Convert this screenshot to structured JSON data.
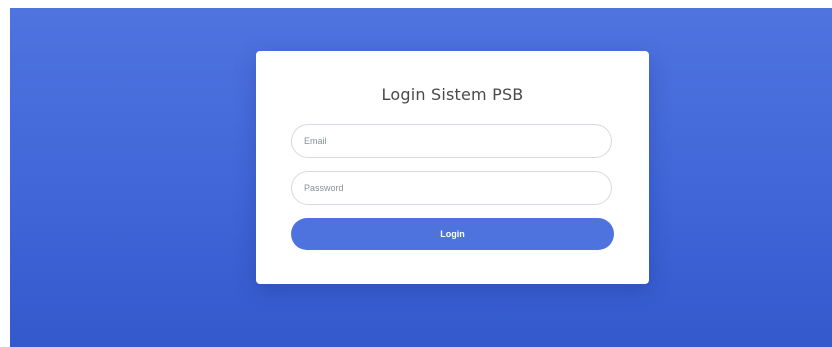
{
  "login": {
    "title": "Login Sistem PSB",
    "email_placeholder": "Email",
    "password_placeholder": "Password",
    "button_label": "Login"
  },
  "colors": {
    "background": "#4e73df",
    "button": "#4e73df",
    "card": "#ffffff"
  }
}
